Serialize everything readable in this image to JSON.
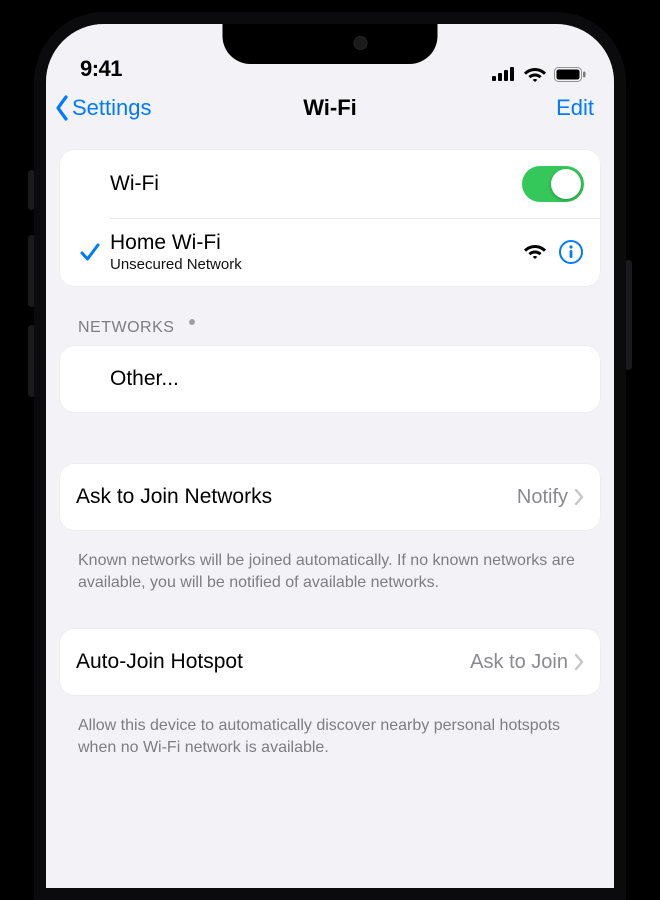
{
  "statusbar": {
    "time": "9:41"
  },
  "nav": {
    "back": "Settings",
    "title": "Wi-Fi",
    "edit": "Edit"
  },
  "wifi": {
    "toggle_label": "Wi-Fi",
    "toggle_on": true,
    "connected": {
      "name": "Home Wi-Fi",
      "subtitle": "Unsecured Network"
    }
  },
  "sections": {
    "networks_header": "NETWORKS",
    "other_label": "Other..."
  },
  "ask_join": {
    "label": "Ask to Join Networks",
    "value": "Notify",
    "footer": "Known networks will be joined automatically. If no known networks are available, you will be notified of available networks."
  },
  "auto_hotspot": {
    "label": "Auto-Join Hotspot",
    "value": "Ask to Join",
    "footer": "Allow this device to automatically discover nearby personal hotspots when no Wi-Fi network is available."
  },
  "colors": {
    "tint": "#007aff",
    "switch_on": "#34c759"
  }
}
